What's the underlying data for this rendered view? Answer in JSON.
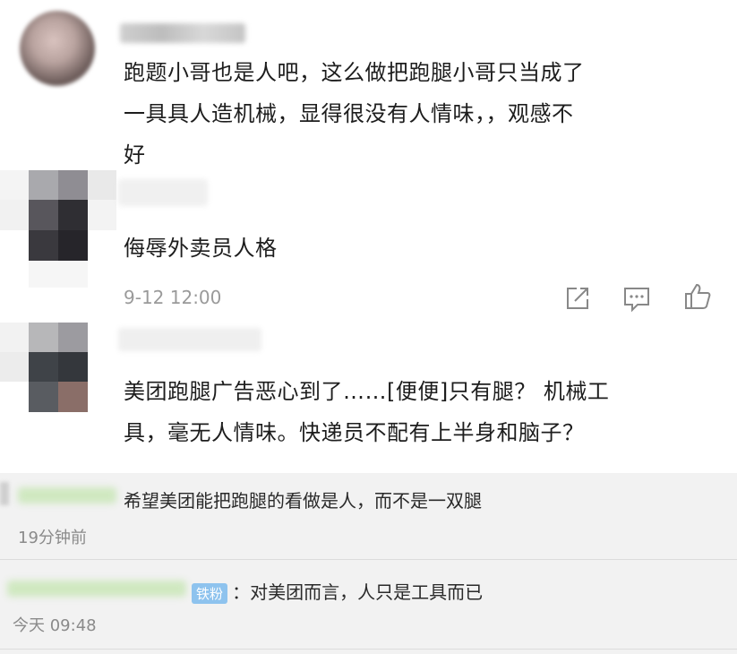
{
  "comments": [
    {
      "text_lines": [
        "跑题小哥也是人吧，这么做把跑腿小哥只当成了",
        "一具具人造机械，显得很没有人情味，，观感不",
        "好"
      ]
    },
    {
      "text_lines": [
        "侮辱外卖员人格"
      ],
      "time": "9-12 12:00"
    },
    {
      "text_lines": [
        "美团跑腿广告恶心到了……[便便]只有腿？ 机械工",
        "具，毫无人情味。快递员不配有上半身和脑子？"
      ]
    }
  ],
  "replies": [
    {
      "text": "希望美团能把跑腿的看做是人，而不是一双腿",
      "time": "19分钟前"
    },
    {
      "badge": "铁粉",
      "text": "：对美团而言，人只是工具而已",
      "time": "今天 09:48"
    }
  ],
  "icons": [
    "share-icon",
    "comment-icon",
    "like-icon"
  ]
}
